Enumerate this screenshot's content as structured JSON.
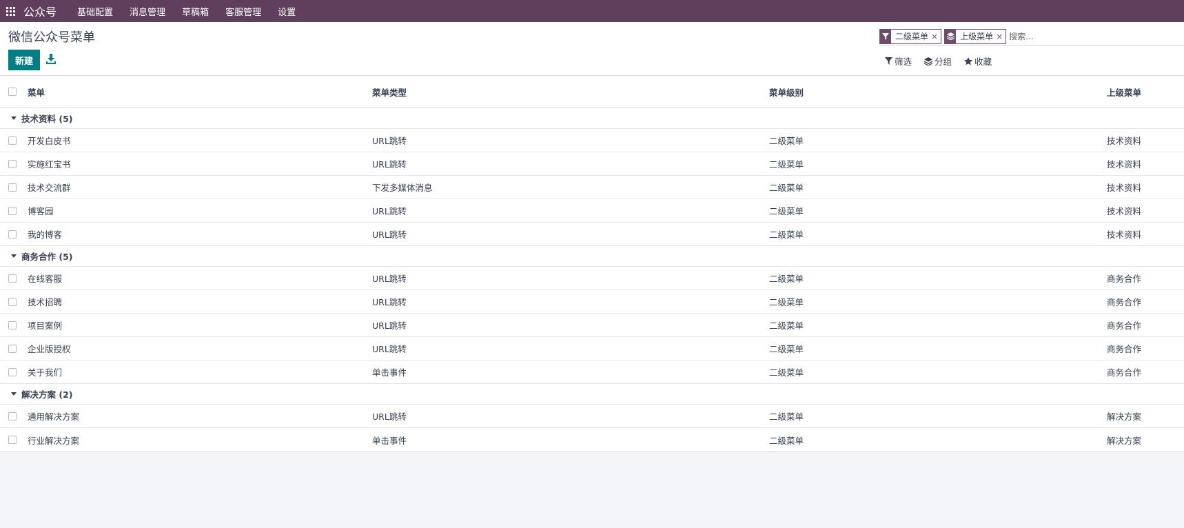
{
  "navbar": {
    "brand": "公众号",
    "items": [
      "基础配置",
      "消息管理",
      "草稿箱",
      "客服管理",
      "设置"
    ]
  },
  "page": {
    "title": "微信公众号菜单",
    "new_button": "新建"
  },
  "search": {
    "facets": [
      {
        "icon": "filter-icon",
        "label": "二级菜单"
      },
      {
        "icon": "layers-icon",
        "label": "上级菜单"
      }
    ],
    "placeholder": "搜索..."
  },
  "options": {
    "filter": "筛选",
    "group": "分组",
    "favorites": "收藏"
  },
  "table": {
    "columns": [
      "菜单",
      "菜单类型",
      "菜单级别",
      "上级菜单"
    ],
    "groups": [
      {
        "label": "技术资料 (5)",
        "rows": [
          [
            "开发白皮书",
            "URL跳转",
            "二级菜单",
            "技术资料"
          ],
          [
            "实施红宝书",
            "URL跳转",
            "二级菜单",
            "技术资料"
          ],
          [
            "技术交流群",
            "下发多媒体消息",
            "二级菜单",
            "技术资料"
          ],
          [
            "博客园",
            "URL跳转",
            "二级菜单",
            "技术资料"
          ],
          [
            "我的博客",
            "URL跳转",
            "二级菜单",
            "技术资料"
          ]
        ]
      },
      {
        "label": "商务合作 (5)",
        "rows": [
          [
            "在线客服",
            "URL跳转",
            "二级菜单",
            "商务合作"
          ],
          [
            "技术招聘",
            "URL跳转",
            "二级菜单",
            "商务合作"
          ],
          [
            "项目案例",
            "URL跳转",
            "二级菜单",
            "商务合作"
          ],
          [
            "企业版授权",
            "URL跳转",
            "二级菜单",
            "商务合作"
          ],
          [
            "关于我们",
            "单击事件",
            "二级菜单",
            "商务合作"
          ]
        ]
      },
      {
        "label": "解决方案 (2)",
        "rows": [
          [
            "通用解决方案",
            "URL跳转",
            "二级菜单",
            "解决方案"
          ],
          [
            "行业解决方案",
            "单击事件",
            "二级菜单",
            "解决方案"
          ]
        ]
      }
    ]
  },
  "colors": {
    "navbar": "#5f3f5b",
    "primary_button": "#017e84",
    "facet": "#6e4d6b"
  }
}
